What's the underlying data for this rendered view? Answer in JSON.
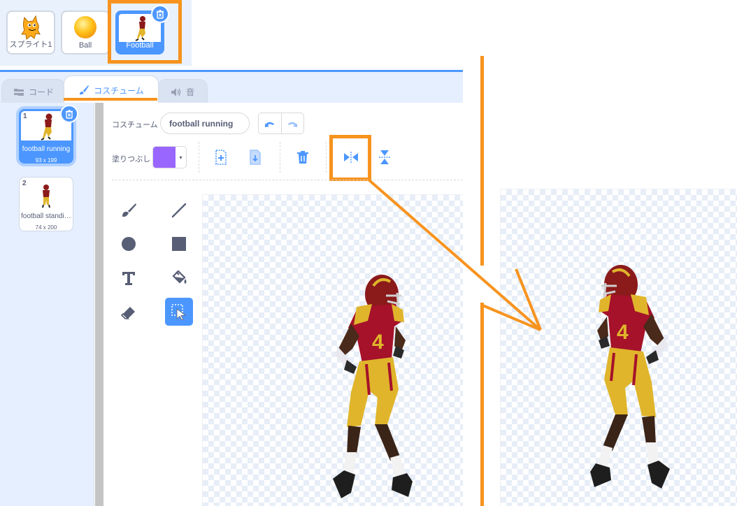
{
  "colors": {
    "accent": "#4c97ff",
    "highlight": "#f7931e",
    "fill": "#9966ff",
    "text": "#575e75"
  },
  "sprites": [
    {
      "name": "スプライト1",
      "icon": "cat-sprite-icon",
      "selected": false
    },
    {
      "name": "Ball",
      "icon": "ball-sprite-icon",
      "selected": false
    },
    {
      "name": "Football",
      "icon": "football-player-sprite-icon",
      "selected": true
    }
  ],
  "tabs": [
    {
      "label": "コード",
      "icon": "code-blocks-icon",
      "active": false
    },
    {
      "label": "コスチューム",
      "icon": "paintbrush-icon",
      "active": true
    },
    {
      "label": "音",
      "icon": "speaker-icon",
      "active": false
    }
  ],
  "costumes": [
    {
      "number": "1",
      "name": "football running",
      "dims": "93 x 199",
      "selected": true
    },
    {
      "number": "2",
      "name": "football standing",
      "dims": "74 x 200",
      "selected": false
    }
  ],
  "toolbar": {
    "costume_label": "コスチューム",
    "costume_name": "football running",
    "fill_label": "塗りつぶし",
    "fill_color": "#9966ff",
    "fill_dropdown": "▾"
  },
  "tools": [
    "brush-tool-icon",
    "line-tool-icon",
    "circle-tool-icon",
    "rectangle-tool-icon",
    "text-tool-icon",
    "fill-tool-icon",
    "eraser-tool-icon",
    "select-tool-icon"
  ]
}
